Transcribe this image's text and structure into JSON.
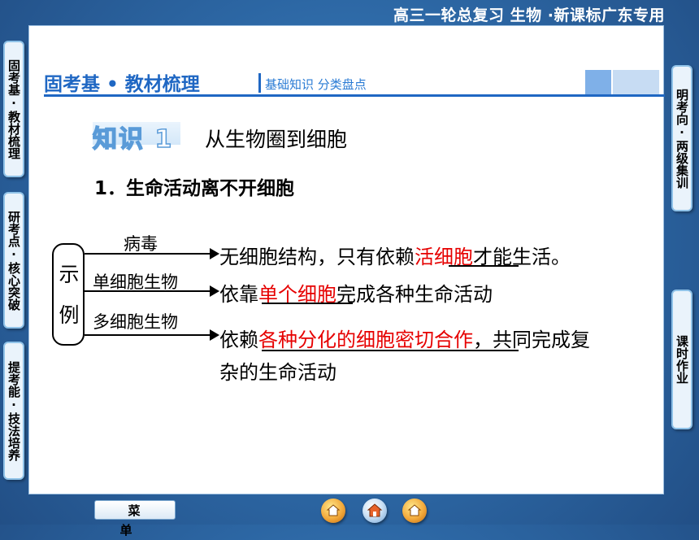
{
  "header": {
    "course_title": "高三一轮总复习 生物 ·新课标广东专用"
  },
  "left_nav": [
    {
      "label": "固考基·教材梳理"
    },
    {
      "label": "研考点·核心突破"
    },
    {
      "label": "提考能·技法培养"
    }
  ],
  "right_nav": [
    {
      "label": "明考向·两级集训"
    },
    {
      "label": "课时作业"
    }
  ],
  "section_bar": {
    "title": "固考基 • 教材梳理",
    "subtitle": "基础知识  分类盘点"
  },
  "knowledge": {
    "badge": "知识 1",
    "name": "从生物圈到细胞"
  },
  "heading": "1．生命活动离不开细胞",
  "diagram": {
    "bracket_label": "示例",
    "rows": [
      {
        "category": "病毒",
        "pre": "无细胞结构，只有依赖",
        "blank": "活细胞",
        "post": "才能生活。"
      },
      {
        "category": "单细胞生物",
        "pre": "依靠",
        "blank": "单个细胞",
        "post": "完成各种生命活动"
      },
      {
        "category": "多细胞生物",
        "pre": "依赖",
        "blank": "各种分化的细胞密切合作",
        "post": "，共同完成复",
        "line2": "杂的生命活动"
      }
    ]
  },
  "bottom": {
    "menu_label": "菜 单",
    "nav_icons": [
      "home-back-icon",
      "house-icon",
      "home-forward-icon"
    ]
  },
  "colors": {
    "accent": "#1f67c3",
    "blank_text": "#e60000",
    "background": "#2e6aa6"
  }
}
